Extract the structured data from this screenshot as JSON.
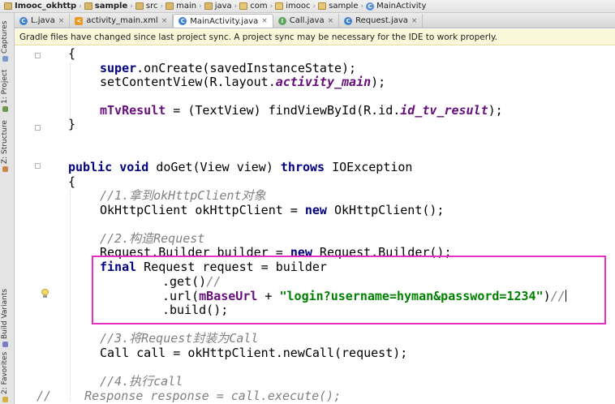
{
  "breadcrumb": [
    "Imooc_okhttp",
    "sample",
    "src",
    "main",
    "java",
    "com",
    "imooc",
    "sample",
    "MainActivity"
  ],
  "tabs": [
    {
      "label": "L.java",
      "icon": "class-icon",
      "active": false
    },
    {
      "label": "activity_main.xml",
      "icon": "xml-icon",
      "active": false
    },
    {
      "label": "MainActivity.java",
      "icon": "class-icon",
      "active": true
    },
    {
      "label": "Call.java",
      "icon": "interface-icon",
      "active": false
    },
    {
      "label": "Request.java",
      "icon": "class-icon",
      "active": false
    }
  ],
  "close_glyph": "×",
  "notice": "Gradle files have changed since last project sync. A project sync may be necessary for the IDE to work properly.",
  "tool_windows": {
    "captures": "Captures",
    "project": "1: Project",
    "structure": "Z: Structure",
    "build_variants": "Build Variants",
    "favorites": "2: Favorites"
  },
  "code": {
    "l1": "{",
    "l2_kw": "super",
    "l2_rest": ".onCreate(savedInstanceState);",
    "l3_a": "setContentView(R.layout.",
    "l3_b": "activity_main",
    "l3_c": ");",
    "l4_a": "mTvResult",
    "l4_b": " = (TextView) findViewById(R.id.",
    "l4_c": "id_tv_result",
    "l4_d": ");",
    "l5": "}",
    "l6_a": "public",
    "l6_b": "void",
    "l6_c": " doGet(View view) ",
    "l6_d": "throws",
    "l6_e": " IOException",
    "l7": "{",
    "l8": "//1.拿到okHttpClient对象",
    "l9_a": "OkHttpClient okHttpClient = ",
    "l9_b": "new",
    "l9_c": " OkHttpClient();",
    "l10": "//2.构造Request",
    "l11_a": "Request.Builder builder = ",
    "l11_b": "new",
    "l11_c": " Request.Builder();",
    "l12_a": "final",
    "l12_b": " Request request = builder",
    "l13_a": ".get()",
    "l13_b": "//",
    "l14_a": ".url(",
    "l14_b": "mBaseUrl",
    "l14_c": " + ",
    "l14_d": "\"login?username=hyman&password=1234\"",
    "l14_e": ")",
    "l14_f": "//",
    "l15": ".build();",
    "l16": "//3.将Request封装为Call",
    "l17": "Call call = okHttpClient.newCall(request);",
    "l18": "//4.执行call",
    "l19_a": "//",
    "l19_b": "   Response response = call.execute();"
  },
  "colors": {
    "keyword": "#000080",
    "field": "#660e7a",
    "string": "#008000",
    "comment": "#808080",
    "highlight_box": "#e52fc5",
    "notice_bg": "#fbf7d9"
  }
}
